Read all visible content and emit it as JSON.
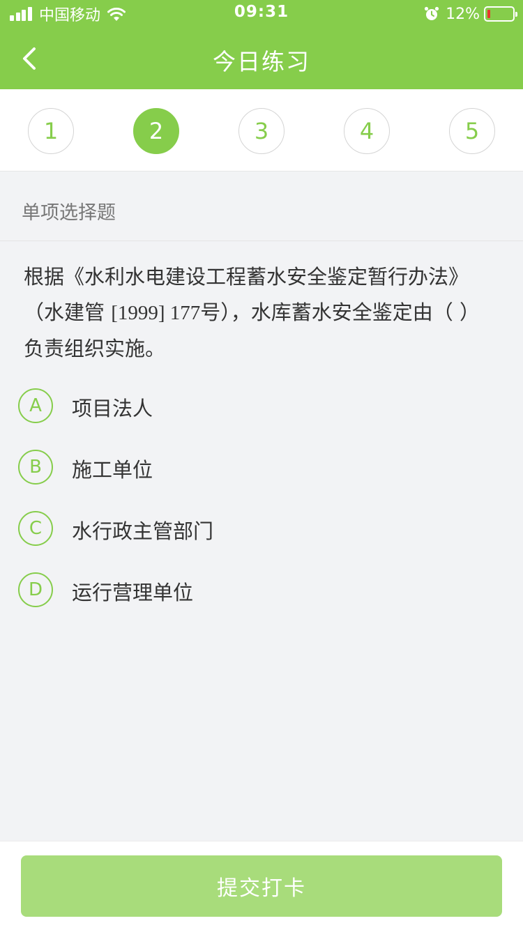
{
  "status_bar": {
    "carrier": "中国移动",
    "time": "09:31",
    "battery": "12%"
  },
  "nav": {
    "title": "今日练习",
    "back_icon": "chevron-left-icon"
  },
  "question_numbers": [
    "1",
    "2",
    "3",
    "4",
    "5"
  ],
  "current_question": "2",
  "question": {
    "type": "单项选择题",
    "stem": {
      "part1": "根据《水利水电建设工程蓄水安全鉴定暂行办法》（水建管 ",
      "part2": "[1999] 177",
      "part3": "号），水库蓄水安全鉴定由（  ）负责组织实施。"
    },
    "options": [
      {
        "letter": "A",
        "text": "项目法人"
      },
      {
        "letter": "B",
        "text": "施工单位"
      },
      {
        "letter": "C",
        "text": "水行政主管部门"
      },
      {
        "letter": "D",
        "text": "运行营理单位"
      }
    ]
  },
  "submit": {
    "label": "提交打卡"
  },
  "colors": {
    "brand_green": "#86cd4b",
    "submit_disabled": "#a8dc7b",
    "background": "#f2f3f5",
    "battery_low": "#e8382f"
  }
}
